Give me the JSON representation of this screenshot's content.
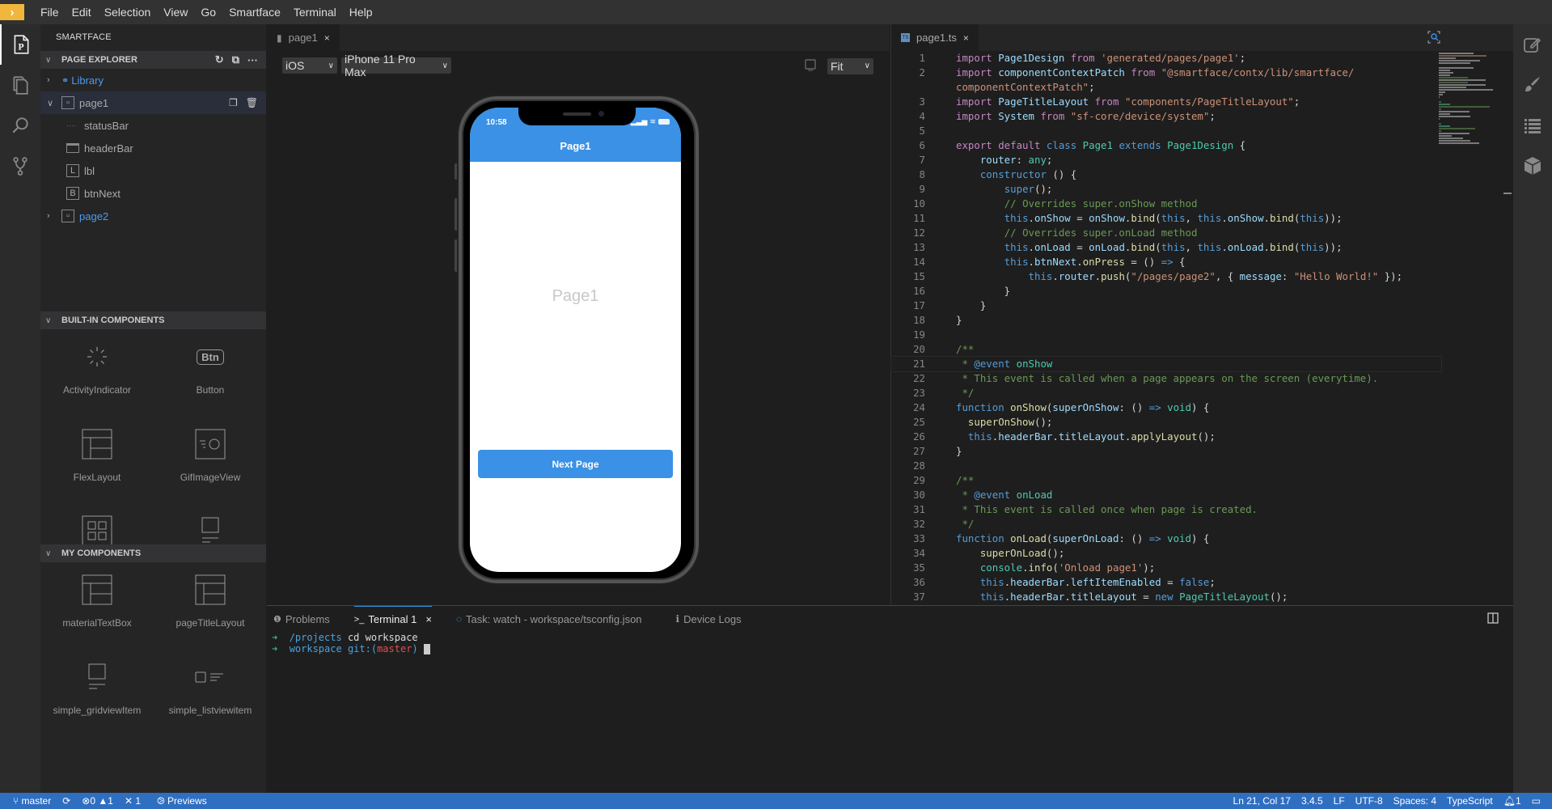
{
  "menubar": {
    "items": [
      "File",
      "Edit",
      "Selection",
      "View",
      "Go",
      "Smartface",
      "Terminal",
      "Help"
    ]
  },
  "activity_bar": {
    "icons": [
      "page-explorer-icon",
      "files-icon",
      "search-icon",
      "source-control-icon"
    ]
  },
  "sidebar": {
    "title": "SMARTFACE",
    "page_explorer": {
      "header": "PAGE EXPLORER",
      "actions": [
        "refresh-icon",
        "collapse-all-icon",
        "more-icon"
      ],
      "items": [
        {
          "label": "Library",
          "icon": "library-icon",
          "expanded": false,
          "link": true
        },
        {
          "label": "page1",
          "icon": "page-icon",
          "expanded": true,
          "selected": true,
          "actions": [
            "duplicate-icon",
            "trash-icon"
          ]
        },
        {
          "label": "statusBar",
          "icon": "statusbar-icon",
          "child": true
        },
        {
          "label": "headerBar",
          "icon": "headerbar-icon",
          "child": true
        },
        {
          "label": "lbl",
          "icon": "label-icon",
          "glyph": "L",
          "child": true
        },
        {
          "label": "btnNext",
          "icon": "button-icon",
          "glyph": "B",
          "child": true
        },
        {
          "label": "page2",
          "icon": "page-icon",
          "expanded": false,
          "link": true
        }
      ]
    },
    "builtin": {
      "header": "BUILT-IN COMPONENTS",
      "items": [
        {
          "label": "ActivityIndicator",
          "icon": "activity-indicator-icon"
        },
        {
          "label": "Button",
          "icon": "button-icon",
          "glyph": "Btn"
        },
        {
          "label": "FlexLayout",
          "icon": "flexlayout-icon"
        },
        {
          "label": "GifImageView",
          "icon": "gifimageview-icon"
        },
        {
          "label": "",
          "icon": "gridview-icon"
        },
        {
          "label": "",
          "icon": "gridviewitem-icon"
        }
      ]
    },
    "mine": {
      "header": "MY COMPONENTS",
      "items": [
        {
          "label": "materialTextBox",
          "icon": "flexlayout-icon"
        },
        {
          "label": "pageTitleLayout",
          "icon": "flexlayout-icon"
        },
        {
          "label": "simple_gridviewItem",
          "icon": "gridviewitem-icon"
        },
        {
          "label": "simple_listviewitem",
          "icon": "listviewitem-icon"
        }
      ]
    }
  },
  "designer": {
    "tab": {
      "label": "page1",
      "close": "×"
    },
    "os_select": "iOS",
    "device_select": "iPhone 11 Pro Max",
    "zoom_select": "Fit",
    "phone": {
      "time": "10:58",
      "header_title": "Page1",
      "label": "Page1",
      "button": "Next Page",
      "accent": "#3a91e6"
    }
  },
  "editor": {
    "tab": {
      "label": "page1.ts",
      "close": "×",
      "badge": "TS"
    },
    "cursor": {
      "line": 21
    },
    "lines": [
      {
        "n": "1",
        "t": [
          [
            "kw",
            "import "
          ],
          [
            "vr",
            "Page1Design "
          ],
          [
            "kw",
            "from "
          ],
          [
            "st",
            "'generated/pages/page1'"
          ],
          [
            "pl",
            ";"
          ]
        ]
      },
      {
        "n": "2",
        "t": [
          [
            "kw",
            "import "
          ],
          [
            "vr",
            "componentContextPatch "
          ],
          [
            "kw",
            "from "
          ],
          [
            "st",
            "\"@smartface/contx/lib/smartface/"
          ]
        ]
      },
      {
        "n": "",
        "t": [
          [
            "st",
            "componentContextPatch\""
          ],
          [
            "pl",
            ";"
          ]
        ]
      },
      {
        "n": "3",
        "t": [
          [
            "kw",
            "import "
          ],
          [
            "vr",
            "PageTitleLayout "
          ],
          [
            "kw",
            "from "
          ],
          [
            "st",
            "\"components/PageTitleLayout\""
          ],
          [
            "pl",
            ";"
          ]
        ]
      },
      {
        "n": "4",
        "t": [
          [
            "kw",
            "import "
          ],
          [
            "vr",
            "System "
          ],
          [
            "kw",
            "from "
          ],
          [
            "st",
            "\"sf-core/device/system\""
          ],
          [
            "pl",
            ";"
          ]
        ]
      },
      {
        "n": "5",
        "t": []
      },
      {
        "n": "6",
        "t": [
          [
            "kw",
            "export default "
          ],
          [
            "kb",
            "class "
          ],
          [
            "ty",
            "Page1 "
          ],
          [
            "kb",
            "extends "
          ],
          [
            "ty",
            "Page1Design "
          ],
          [
            "pl",
            "{"
          ]
        ]
      },
      {
        "n": "7",
        "t": [
          [
            "pl",
            "    "
          ],
          [
            "vr",
            "router"
          ],
          [
            "pl",
            ": "
          ],
          [
            "ty",
            "any"
          ],
          [
            "pl",
            ";"
          ]
        ]
      },
      {
        "n": "8",
        "t": [
          [
            "pl",
            "    "
          ],
          [
            "kb",
            "constructor "
          ],
          [
            "pl",
            "() {"
          ]
        ]
      },
      {
        "n": "9",
        "t": [
          [
            "pl",
            "        "
          ],
          [
            "kb",
            "super"
          ],
          [
            "pl",
            "();"
          ]
        ]
      },
      {
        "n": "10",
        "t": [
          [
            "pl",
            "        "
          ],
          [
            "cm",
            "// Overrides super.onShow method"
          ]
        ]
      },
      {
        "n": "11",
        "t": [
          [
            "pl",
            "        "
          ],
          [
            "kb",
            "this"
          ],
          [
            "pl",
            "."
          ],
          [
            "vr",
            "onShow"
          ],
          [
            "pl",
            " = "
          ],
          [
            "vr",
            "onShow"
          ],
          [
            "pl",
            "."
          ],
          [
            "fn",
            "bind"
          ],
          [
            "pl",
            "("
          ],
          [
            "kb",
            "this"
          ],
          [
            "pl",
            ", "
          ],
          [
            "kb",
            "this"
          ],
          [
            "pl",
            "."
          ],
          [
            "vr",
            "onShow"
          ],
          [
            "pl",
            "."
          ],
          [
            "fn",
            "bind"
          ],
          [
            "pl",
            "("
          ],
          [
            "kb",
            "this"
          ],
          [
            "pl",
            "));"
          ]
        ]
      },
      {
        "n": "12",
        "t": [
          [
            "pl",
            "        "
          ],
          [
            "cm",
            "// Overrides super.onLoad method"
          ]
        ]
      },
      {
        "n": "13",
        "t": [
          [
            "pl",
            "        "
          ],
          [
            "kb",
            "this"
          ],
          [
            "pl",
            "."
          ],
          [
            "vr",
            "onLoad"
          ],
          [
            "pl",
            " = "
          ],
          [
            "vr",
            "onLoad"
          ],
          [
            "pl",
            "."
          ],
          [
            "fn",
            "bind"
          ],
          [
            "pl",
            "("
          ],
          [
            "kb",
            "this"
          ],
          [
            "pl",
            ", "
          ],
          [
            "kb",
            "this"
          ],
          [
            "pl",
            "."
          ],
          [
            "vr",
            "onLoad"
          ],
          [
            "pl",
            "."
          ],
          [
            "fn",
            "bind"
          ],
          [
            "pl",
            "("
          ],
          [
            "kb",
            "this"
          ],
          [
            "pl",
            "));"
          ]
        ]
      },
      {
        "n": "14",
        "t": [
          [
            "pl",
            "        "
          ],
          [
            "kb",
            "this"
          ],
          [
            "pl",
            "."
          ],
          [
            "vr",
            "btnNext"
          ],
          [
            "pl",
            "."
          ],
          [
            "fn",
            "onPress"
          ],
          [
            "pl",
            " = () "
          ],
          [
            "kb",
            "=>"
          ],
          [
            "pl",
            " {"
          ]
        ]
      },
      {
        "n": "15",
        "t": [
          [
            "pl",
            "            "
          ],
          [
            "kb",
            "this"
          ],
          [
            "pl",
            "."
          ],
          [
            "vr",
            "router"
          ],
          [
            "pl",
            "."
          ],
          [
            "fn",
            "push"
          ],
          [
            "pl",
            "("
          ],
          [
            "st",
            "\"/pages/page2\""
          ],
          [
            "pl",
            ", { "
          ],
          [
            "vr",
            "message"
          ],
          [
            "pl",
            ": "
          ],
          [
            "st",
            "\"Hello World!\""
          ],
          [
            "pl",
            " });"
          ]
        ]
      },
      {
        "n": "16",
        "t": [
          [
            "pl",
            "        }"
          ]
        ]
      },
      {
        "n": "17",
        "t": [
          [
            "pl",
            "    }"
          ]
        ]
      },
      {
        "n": "18",
        "t": [
          [
            "pl",
            "}"
          ]
        ]
      },
      {
        "n": "19",
        "t": []
      },
      {
        "n": "20",
        "t": [
          [
            "cm",
            "/**"
          ]
        ]
      },
      {
        "n": "21",
        "t": [
          [
            "cm",
            " * "
          ],
          [
            "kb",
            "@event "
          ],
          [
            "ty",
            "onShow"
          ]
        ]
      },
      {
        "n": "22",
        "t": [
          [
            "cm",
            " * This event is called when a page appears on the screen (everytime)."
          ]
        ]
      },
      {
        "n": "23",
        "t": [
          [
            "cm",
            " */"
          ]
        ]
      },
      {
        "n": "24",
        "t": [
          [
            "kb",
            "function "
          ],
          [
            "fn",
            "onShow"
          ],
          [
            "pl",
            "("
          ],
          [
            "vr",
            "superOnShow"
          ],
          [
            "pl",
            ": () "
          ],
          [
            "kb",
            "=>"
          ],
          [
            "pl",
            " "
          ],
          [
            "ty",
            "void"
          ],
          [
            "pl",
            ") {"
          ]
        ]
      },
      {
        "n": "25",
        "t": [
          [
            "pl",
            "  "
          ],
          [
            "fn",
            "superOnShow"
          ],
          [
            "pl",
            "();"
          ]
        ]
      },
      {
        "n": "26",
        "t": [
          [
            "pl",
            "  "
          ],
          [
            "kb",
            "this"
          ],
          [
            "pl",
            "."
          ],
          [
            "vr",
            "headerBar"
          ],
          [
            "pl",
            "."
          ],
          [
            "vr",
            "titleLayout"
          ],
          [
            "pl",
            "."
          ],
          [
            "fn",
            "applyLayout"
          ],
          [
            "pl",
            "();"
          ]
        ]
      },
      {
        "n": "27",
        "t": [
          [
            "pl",
            "}"
          ]
        ]
      },
      {
        "n": "28",
        "t": []
      },
      {
        "n": "29",
        "t": [
          [
            "cm",
            "/**"
          ]
        ]
      },
      {
        "n": "30",
        "t": [
          [
            "cm",
            " * "
          ],
          [
            "kb",
            "@event "
          ],
          [
            "ty",
            "onLoad"
          ]
        ]
      },
      {
        "n": "31",
        "t": [
          [
            "cm",
            " * This event is called once when page is created."
          ]
        ]
      },
      {
        "n": "32",
        "t": [
          [
            "cm",
            " */"
          ]
        ]
      },
      {
        "n": "33",
        "t": [
          [
            "kb",
            "function "
          ],
          [
            "fn",
            "onLoad"
          ],
          [
            "pl",
            "("
          ],
          [
            "vr",
            "superOnLoad"
          ],
          [
            "pl",
            ": () "
          ],
          [
            "kb",
            "=>"
          ],
          [
            "pl",
            " "
          ],
          [
            "ty",
            "void"
          ],
          [
            "pl",
            ") {"
          ]
        ]
      },
      {
        "n": "34",
        "t": [
          [
            "pl",
            "    "
          ],
          [
            "fn",
            "superOnLoad"
          ],
          [
            "pl",
            "();"
          ]
        ]
      },
      {
        "n": "35",
        "t": [
          [
            "pl",
            "    "
          ],
          [
            "ty",
            "console"
          ],
          [
            "pl",
            "."
          ],
          [
            "fn",
            "info"
          ],
          [
            "pl",
            "("
          ],
          [
            "st",
            "'Onload page1'"
          ],
          [
            "pl",
            ");"
          ]
        ]
      },
      {
        "n": "36",
        "t": [
          [
            "pl",
            "    "
          ],
          [
            "kb",
            "this"
          ],
          [
            "pl",
            "."
          ],
          [
            "vr",
            "headerBar"
          ],
          [
            "pl",
            "."
          ],
          [
            "vr",
            "leftItemEnabled"
          ],
          [
            "pl",
            " = "
          ],
          [
            "kb",
            "false"
          ],
          [
            "pl",
            ";"
          ]
        ]
      },
      {
        "n": "37",
        "t": [
          [
            "pl",
            "    "
          ],
          [
            "kb",
            "this"
          ],
          [
            "pl",
            "."
          ],
          [
            "vr",
            "headerBar"
          ],
          [
            "pl",
            "."
          ],
          [
            "vr",
            "titleLayout"
          ],
          [
            "pl",
            " = "
          ],
          [
            "kb",
            "new "
          ],
          [
            "ty",
            "PageTitleLayout"
          ],
          [
            "pl",
            "();"
          ]
        ]
      }
    ]
  },
  "right_bar": {
    "icons": [
      "edit-icon",
      "brush-icon",
      "list-icon",
      "cube-icon"
    ]
  },
  "panel": {
    "tabs": [
      {
        "label": "Problems",
        "icon": "info-circle-icon"
      },
      {
        "label": "Terminal 1",
        "icon": "terminal-icon",
        "active": true,
        "close": "×"
      },
      {
        "label": "Task: watch - workspace/tsconfig.json",
        "icon": "spinner-icon"
      },
      {
        "label": "Device Logs",
        "icon": "info-icon"
      }
    ],
    "terminal": {
      "line1": {
        "arrow": "➜",
        "dir": "/projects",
        "cmd": " cd workspace"
      },
      "line2": {
        "arrow": "➜",
        "dir": "workspace",
        "git_prefix": " git:(",
        "branch": "master",
        "git_suffix": ")"
      }
    }
  },
  "statusbar": {
    "branch": "master",
    "errors": "0",
    "warnings": "1",
    "tools": "1",
    "previews": "Previews",
    "position": "Ln 21, Col 17",
    "version": "3.4.5",
    "eol": "LF",
    "encoding": "UTF-8",
    "indent": "Spaces: 4",
    "language": "TypeScript",
    "notifications": "1",
    "color": "#2f6fc2"
  }
}
